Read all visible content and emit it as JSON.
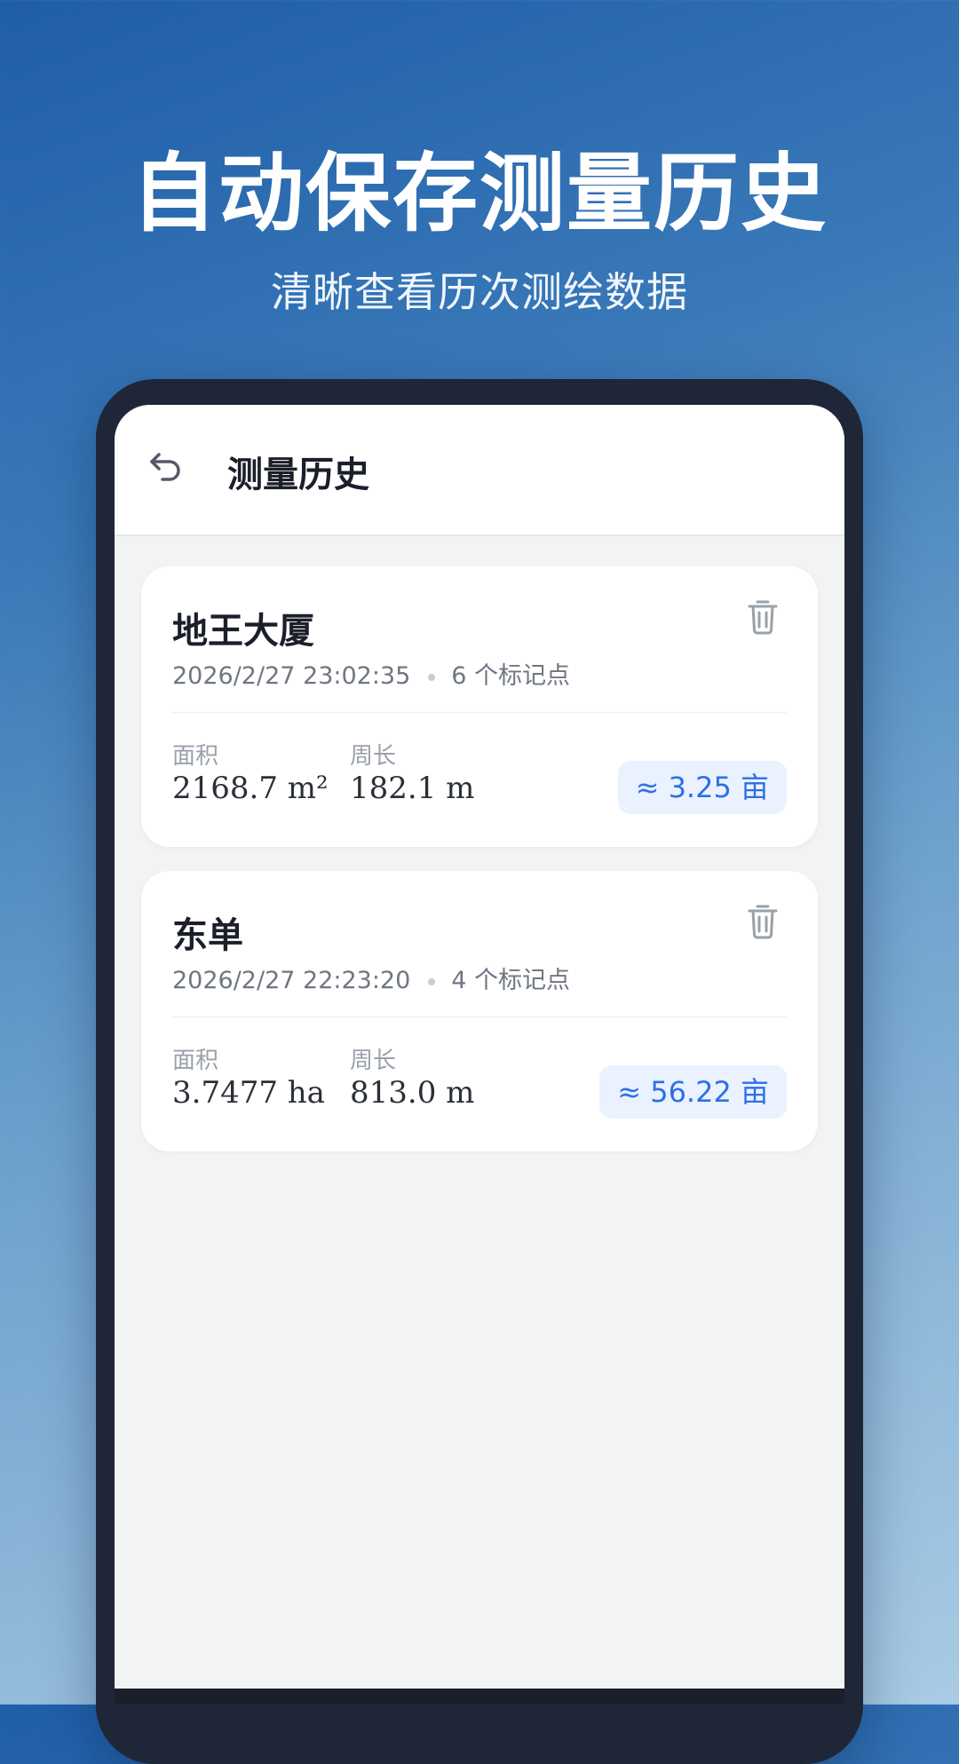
{
  "promo": {
    "title": "自动保存测量历史",
    "subtitle": "清晰查看历次测绘数据"
  },
  "header": {
    "back_icon": "back-arrow-icon",
    "title": "测量历史"
  },
  "records": [
    {
      "name": "地王大厦",
      "datetime": "2026/2/27 23:02:35",
      "points": "6 个标记点",
      "area_label": "面积",
      "area_value": "2168.7 m²",
      "perimeter_label": "周长",
      "perimeter_value": "182.1 m",
      "mu": "≈ 3.25 亩",
      "delete_icon": "trash-icon"
    },
    {
      "name": "东单",
      "datetime": "2026/2/27 22:23:20",
      "points": "4 个标记点",
      "area_label": "面积",
      "area_value": "3.7477 ha",
      "perimeter_label": "周长",
      "perimeter_value": "813.0 m",
      "mu": "≈ 56.22 亩",
      "delete_icon": "trash-icon"
    }
  ],
  "colors": {
    "accent": "#2f6fe4",
    "badge_bg": "#eaf2ff",
    "frame": "#1f2638"
  }
}
